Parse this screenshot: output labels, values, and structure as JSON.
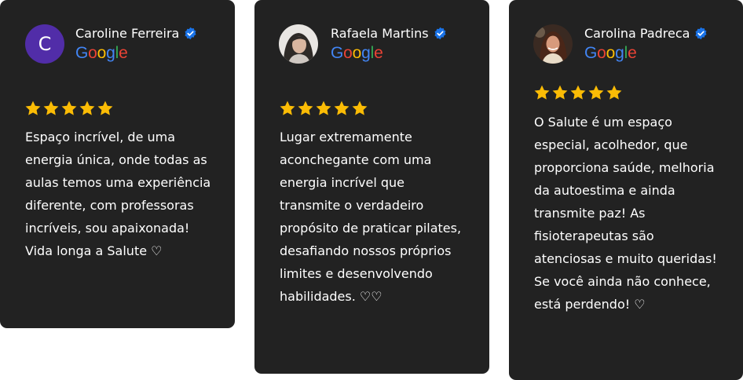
{
  "colors": {
    "card_background": "#222222",
    "page_background": "#ffffff",
    "star": "#fbbc05",
    "verified": "#1a73e8",
    "avatar_letter_bg": "#512da8"
  },
  "reviews": [
    {
      "avatar_letter": "C",
      "name": "Caroline Ferreira",
      "platform": [
        "G",
        "o",
        "o",
        "g",
        "l",
        "e"
      ],
      "rating": 5,
      "text": "Espaço incrível, de uma energia única, onde todas as aulas temos uma experiência diferente, com professoras incríveis, sou apaixonada! Vida longa a Salute ♡"
    },
    {
      "avatar_letter": "",
      "name": "Rafaela Martins",
      "platform": [
        "G",
        "o",
        "o",
        "g",
        "l",
        "e"
      ],
      "rating": 5,
      "text": "Lugar extremamente aconchegante com uma energia incrível que transmite o verdadeiro propósito de praticar pilates, desafiando nossos próprios limites e desenvolvendo habilidades. ♡♡"
    },
    {
      "avatar_letter": "",
      "name": "Carolina Padreca",
      "platform": [
        "G",
        "o",
        "o",
        "g",
        "l",
        "e"
      ],
      "rating": 5,
      "text": "O Salute é um espaço especial, acolhedor, que proporciona saúde, melhoria da autoestima e ainda transmite paz! As fisioterapeutas são atenciosas e muito queridas! Se você ainda não conhece, está perdendo! ♡"
    }
  ]
}
